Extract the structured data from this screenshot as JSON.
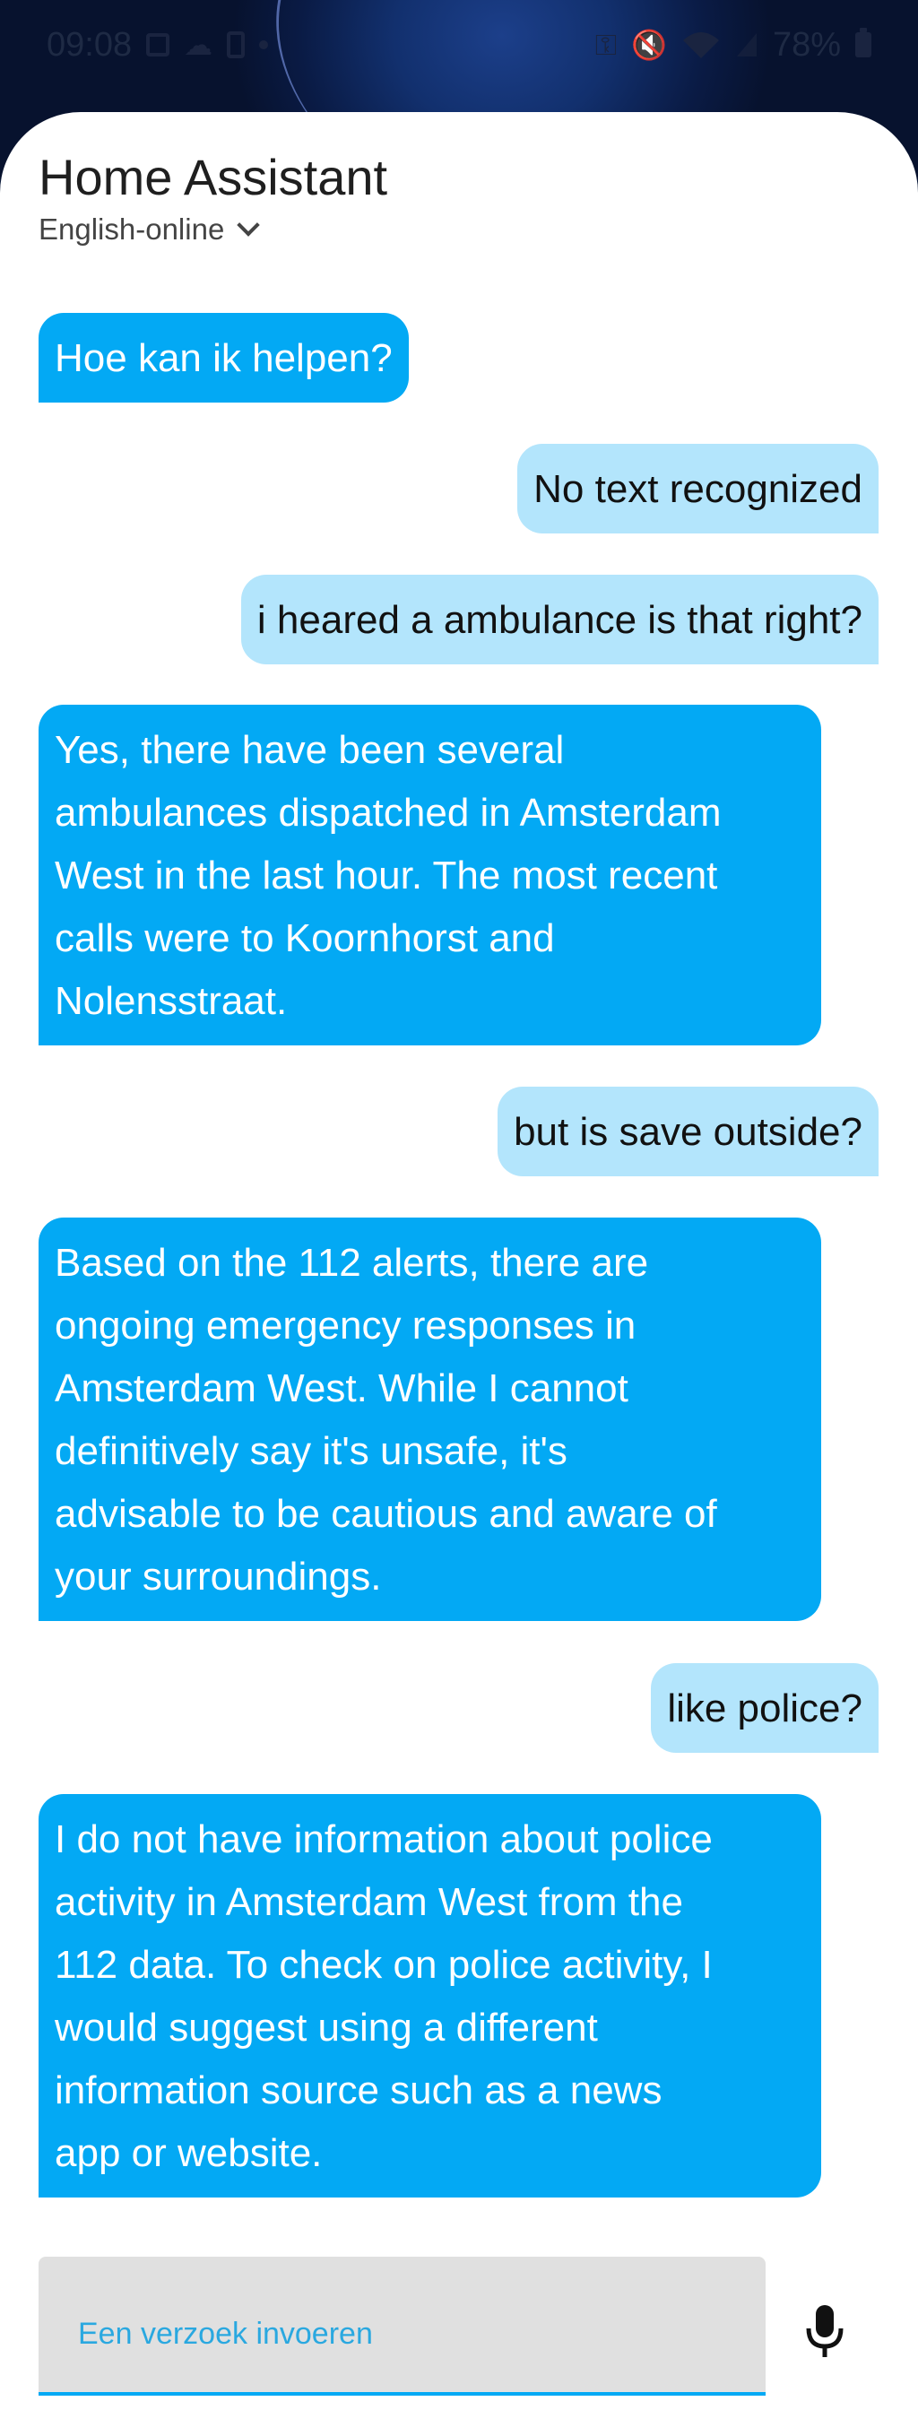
{
  "status_bar": {
    "time": "09:08",
    "battery": "78%"
  },
  "header": {
    "title": "Home Assistant",
    "language": "English-online"
  },
  "messages": [
    {
      "role": "assistant",
      "lines": [
        "Hoe kan ik helpen?"
      ]
    },
    {
      "role": "user",
      "lines": [
        "No text recognized"
      ]
    },
    {
      "role": "user",
      "lines": [
        "i heared a ambulance is that right?"
      ]
    },
    {
      "role": "assistant",
      "lines": [
        "Yes, there have been several",
        "ambulances dispatched in Amsterdam",
        "West in the last hour.  The most recent",
        "calls were to Koornhorst and",
        "Nolensstraat."
      ]
    },
    {
      "role": "user",
      "lines": [
        "but is save outside?"
      ]
    },
    {
      "role": "assistant",
      "lines": [
        "Based on the 112 alerts, there are",
        "ongoing emergency responses in",
        "Amsterdam West.  While I cannot",
        "definitively say it's unsafe, it's",
        "advisable to be cautious and aware of",
        "your surroundings."
      ]
    },
    {
      "role": "user",
      "lines": [
        "like police?"
      ]
    },
    {
      "role": "assistant",
      "lines": [
        "I do not have information about police",
        "activity in Amsterdam West from the",
        "112 data.  To check on police activity, I",
        "would suggest using a different",
        "information source such as a news",
        "app or website."
      ]
    }
  ],
  "input": {
    "placeholder": "Een verzoek invoeren",
    "value": ""
  },
  "colors": {
    "assistant_bubble": "#03a9f4",
    "user_bubble": "#b3e5fc",
    "accent": "#03a9f4"
  },
  "icons": {
    "mic": "microphone-icon",
    "language_dropdown": "chevron-down-icon"
  }
}
